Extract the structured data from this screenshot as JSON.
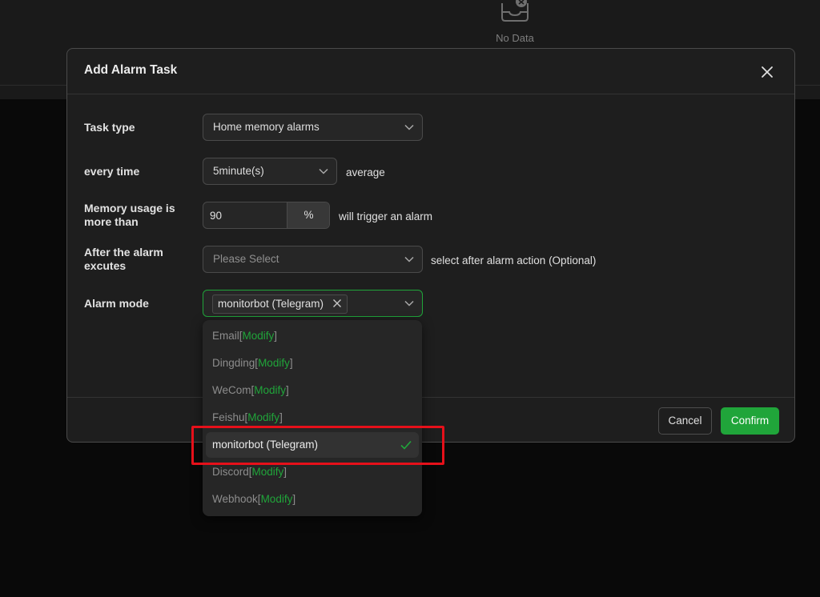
{
  "background": {
    "empty_text": "No Data",
    "empty_icon": "empty-inbox-icon"
  },
  "dialog": {
    "title": "Add Alarm Task",
    "close_icon": "close-icon"
  },
  "form": {
    "task_type": {
      "label": "Task type",
      "value": "Home memory alarms"
    },
    "every_time": {
      "label": "every time",
      "value": "5minute(s)",
      "suffix": "average"
    },
    "memory": {
      "label": "Memory usage is more than",
      "value": "90",
      "unit": "%",
      "suffix": "will trigger an alarm"
    },
    "after_alarm": {
      "label": "After the alarm excutes",
      "placeholder": "Please Select",
      "suffix": "select after alarm action (Optional)"
    },
    "alarm_mode": {
      "label": "Alarm mode",
      "tag": "monitorbot (Telegram)"
    }
  },
  "dropdown": {
    "modify_text": "Modify",
    "options": [
      {
        "name": "Email",
        "has_modify": true,
        "selected": false
      },
      {
        "name": "Dingding",
        "has_modify": true,
        "selected": false
      },
      {
        "name": "WeCom",
        "has_modify": true,
        "selected": false
      },
      {
        "name": "Feishu",
        "has_modify": true,
        "selected": false
      },
      {
        "name": "monitorbot (Telegram)",
        "has_modify": false,
        "selected": true
      },
      {
        "name": "Discord",
        "has_modify": true,
        "selected": false
      },
      {
        "name": "Webhook",
        "has_modify": true,
        "selected": false
      }
    ]
  },
  "buttons": {
    "cancel": "Cancel",
    "confirm": "Confirm"
  },
  "colors": {
    "accent": "#20a53a",
    "highlight": "#e6101a",
    "dialog_bg": "#1e1e1e"
  }
}
